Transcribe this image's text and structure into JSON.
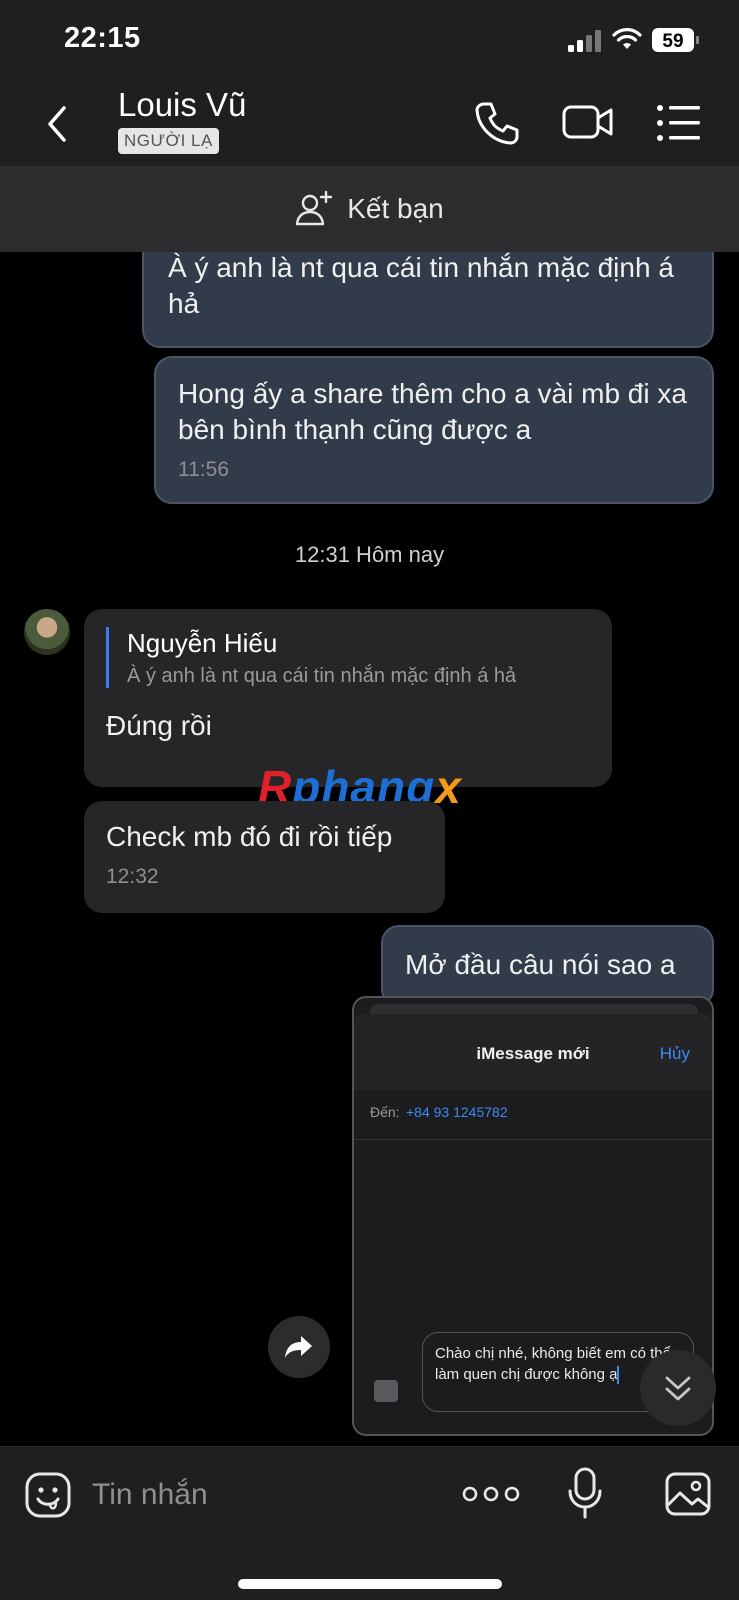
{
  "status_bar": {
    "time": "22:15",
    "battery": "59"
  },
  "header": {
    "contact_name": "Louis Vũ",
    "badge": "NGƯỜI LẠ",
    "icons": [
      "chevron-left-icon",
      "phone-icon",
      "video-camera-icon",
      "menu-list-icon"
    ]
  },
  "add_friend": {
    "label": "Kết bạn",
    "icon": "add-user-icon"
  },
  "messages": [
    {
      "direction": "out",
      "text": "À ý anh là nt qua cái tin nhắn mặc định á hả"
    },
    {
      "direction": "out",
      "text": "Hong ấy a share thêm cho a vài mb đi xa bên bình thạnh cũng được a",
      "time": "11:56"
    },
    {
      "separator": "12:31 Hôm nay"
    },
    {
      "direction": "in",
      "quote_author": "Nguyễn Hiếu",
      "quote_text": "À ý anh là nt qua cái tin nhắn mặc định á hả",
      "text": "Đúng rồi"
    },
    {
      "direction": "in",
      "text": "Check mb đó đi rồi tiếp",
      "time": "12:32"
    },
    {
      "direction": "out",
      "text": "Mở đầu câu nói sao a"
    }
  ],
  "watermark": {
    "part1": "R",
    "part2": "phang",
    "part3": "x"
  },
  "image_message": {
    "title": "iMessage mới",
    "cancel": "Hủy",
    "to_label": "Đến:",
    "to_value": "+84 93 1245782",
    "draft": "Chào chị nhé, không biết em có thể làm quen chị được không ạ"
  },
  "input": {
    "placeholder": "Tin nhắn"
  },
  "colors": {
    "accent": "#3a7bf5",
    "outgoing_bubble": "#323b4a",
    "incoming_bubble": "#262628"
  }
}
